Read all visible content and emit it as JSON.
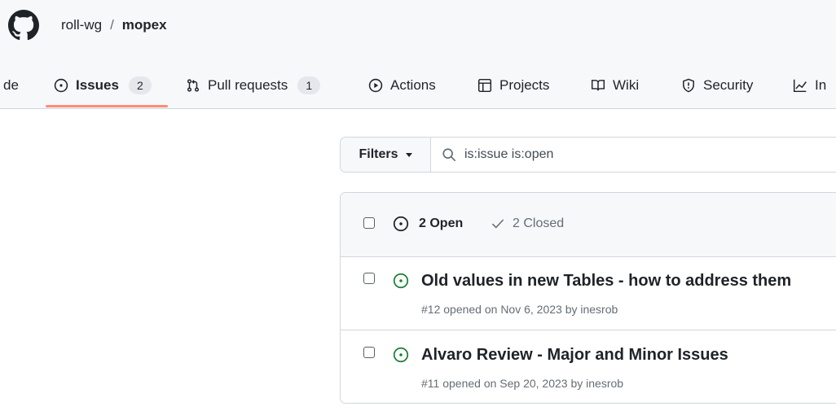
{
  "repo": {
    "owner": "roll-wg",
    "separator": "/",
    "name": "mopex"
  },
  "nav": {
    "code_partial": "de",
    "issues": {
      "label": "Issues",
      "count": "2"
    },
    "pull_requests": {
      "label": "Pull requests",
      "count": "1"
    },
    "actions": "Actions",
    "projects": "Projects",
    "wiki": "Wiki",
    "security": "Security",
    "insights_partial": "In"
  },
  "filters": {
    "button_label": "Filters",
    "search_value": "is:issue is:open"
  },
  "issue_list": {
    "open_label": "2 Open",
    "closed_label": "2 Closed",
    "items": [
      {
        "title": "Old values in new Tables - how to address them",
        "meta": "#12 opened on Nov 6, 2023 by inesrob"
      },
      {
        "title": "Alvaro Review - Major and Minor Issues",
        "meta": "#11 opened on Sep 20, 2023 by inesrob"
      }
    ]
  },
  "colors": {
    "open_issue": "#1a7f37",
    "tab_underline": "#fd8c73",
    "border": "#d0d7de",
    "header_bg": "#f6f8fa"
  }
}
